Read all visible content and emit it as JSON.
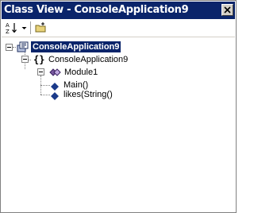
{
  "window": {
    "title": "Class View - ConsoleApplication9"
  },
  "toolbar": {
    "sort_icon": "sort-az-icon",
    "dropdown_icon": "chevron-down-icon",
    "new_folder_icon": "new-folder-icon"
  },
  "tree": {
    "nodes": [
      {
        "label": "ConsoleApplication9",
        "icon": "project-icon",
        "selected": true
      },
      {
        "label": "ConsoleApplication9",
        "icon": "namespace-braces-icon"
      },
      {
        "label": "Module1",
        "icon": "module-icon"
      },
      {
        "label": "Main()",
        "icon": "method-icon"
      },
      {
        "label": "likes(String()",
        "icon": "method-icon"
      }
    ]
  },
  "colors": {
    "titlebar": "#0a246a",
    "selection": "#0a246a",
    "method_icon": "#1a3a8a"
  }
}
